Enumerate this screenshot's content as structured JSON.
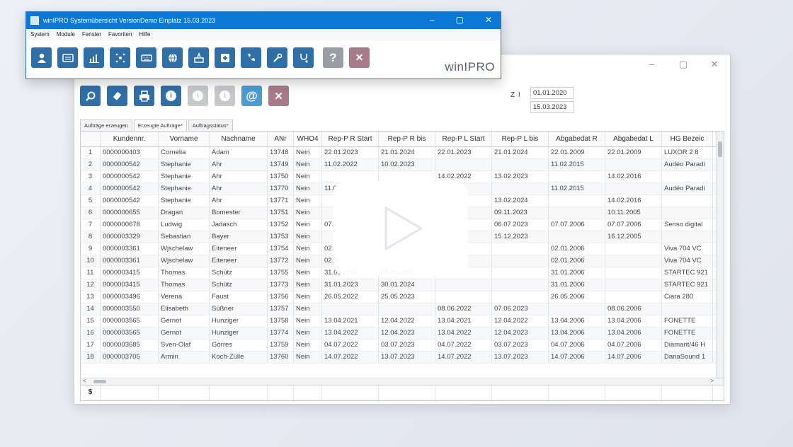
{
  "front_window": {
    "title": "winIPRO Systemübersicht VersionDemo Einplatz 15.03.2023",
    "menu": [
      "System",
      "Module",
      "Fenster",
      "Favoriten",
      "Hilfe"
    ],
    "logo": "winIPRO",
    "toolbar_icons": [
      "user-icon",
      "id-card-icon",
      "bar-chart-icon",
      "network-icon",
      "keyboard-icon",
      "globe-icon",
      "money-icon",
      "plus-box-icon",
      "phone-icon",
      "tools-icon",
      "stethoscope-icon",
      "help-icon",
      "close-icon"
    ],
    "help_glyph": "?",
    "close_glyph": "✕",
    "ctrl_min": "–",
    "ctrl_max": "▢",
    "ctrl_close": "✕"
  },
  "main_window": {
    "ctrl_min": "–",
    "ctrl_max": "▢",
    "ctrl_close": "✕",
    "toolbar_icons": [
      "search-icon",
      "eraser-icon",
      "print-icon",
      "info-icon",
      "info-disabled-icon",
      "info-disabled-icon",
      "email-icon",
      "close-icon"
    ],
    "info_glyph": "i",
    "email_glyph": "@",
    "close_glyph": "✕",
    "zi_label": "Z I",
    "date_from": "01.01.2020",
    "date_to": "15.03.2023",
    "tabs": [
      "Aufträge erzeugen",
      "Erzeugte Aufträge*",
      "Auftragsstatus*"
    ],
    "active_tab": 1
  },
  "table": {
    "columns": [
      "",
      "Kundennr.",
      "Vorname",
      "Nachname",
      "ANr",
      "WHO4",
      "Rep-P R Start",
      "Rep-P R bis",
      "Rep-P L Start",
      "Rep-P L bis",
      "Abgabedat R",
      "Abgabedat L",
      "HG Bezeic"
    ],
    "rows": [
      [
        "1",
        "0000000403",
        "Cornelia",
        "Adam",
        "13748",
        "Nein",
        "22.01.2023",
        "21.01.2024",
        "22.01.2023",
        "21.01.2024",
        "22.01.2009",
        "22.01.2009",
        "LUXOR 2 8"
      ],
      [
        "2",
        "0000000542",
        "Stephanie",
        "Ahr",
        "13749",
        "Nein",
        "11.02.2022",
        "10.02.2023",
        "",
        "",
        "11.02.2015",
        "",
        "Audéo Paradi"
      ],
      [
        "3",
        "0000000542",
        "Stephanie",
        "Ahr",
        "13750",
        "Nein",
        "",
        "",
        "14.02.2022",
        "13.02.2023",
        "",
        "14.02.2016",
        ""
      ],
      [
        "4",
        "0000000542",
        "Stephanie",
        "Ahr",
        "13770",
        "Nein",
        "11.0",
        "",
        "",
        "",
        "11.02.2015",
        "",
        "Audéo Paradi"
      ],
      [
        "5",
        "0000000542",
        "Stephanie",
        "Ahr",
        "13771",
        "Nein",
        "",
        "",
        "",
        "13.02.2024",
        "",
        "14.02.2016",
        ""
      ],
      [
        "6",
        "0000000655",
        "Dragan",
        "Bomester",
        "13751",
        "Nein",
        "",
        "",
        "",
        "09.11.2023",
        "",
        "10.11.2005",
        ""
      ],
      [
        "7",
        "0000000678",
        "Ludwig",
        "Jadasch",
        "13752",
        "Nein",
        "07.",
        "",
        "",
        "06.07.2023",
        "07.07.2006",
        "07.07.2006",
        "Senso digital"
      ],
      [
        "8",
        "0000003329",
        "Sebastian",
        "Bayer",
        "13753",
        "Nein",
        "",
        "",
        "",
        "15.12.2023",
        "",
        "16.12.2005",
        ""
      ],
      [
        "9",
        "0000003361",
        "Wjschelaw",
        "Eiteneer",
        "13754",
        "Nein",
        "02.",
        "",
        "",
        "",
        "02.01.2006",
        "",
        "Viva 704 VC"
      ],
      [
        "10",
        "0000003361",
        "Wjschelaw",
        "Eiteneer",
        "13772",
        "Nein",
        "02.01",
        "",
        "",
        "",
        "02.01.2006",
        "",
        "Viva 704 VC"
      ],
      [
        "11",
        "0000003415",
        "Thomas",
        "Schütz",
        "13755",
        "Nein",
        "31.01.2022",
        "30.01.2023",
        "",
        "",
        "31.01.2006",
        "",
        "STARTEC 921"
      ],
      [
        "12",
        "0000003415",
        "Thomas",
        "Schütz",
        "13773",
        "Nein",
        "31.01.2023",
        "30.01.2024",
        "",
        "",
        "31.01.2006",
        "",
        "STARTEC 921"
      ],
      [
        "13",
        "0000003496",
        "Verena",
        "Faust",
        "13756",
        "Nein",
        "26.05.2022",
        "25.05.2023",
        "",
        "",
        "26.05.2006",
        "",
        "Ciara 280"
      ],
      [
        "14",
        "0000003550",
        "Elisabeth",
        "Süßner",
        "13757",
        "Nein",
        "",
        "",
        "08.06.2022",
        "07.06.2023",
        "",
        "08.06.2006",
        ""
      ],
      [
        "15",
        "0000003565",
        "Gernot",
        "Hunziger",
        "13758",
        "Nein",
        "13.04.2021",
        "12.04.2022",
        "13.04.2021",
        "12.04.2022",
        "13.04.2006",
        "13.04.2006",
        "FONETTE"
      ],
      [
        "16",
        "0000003565",
        "Gernot",
        "Hunziger",
        "13774",
        "Nein",
        "13.04.2022",
        "12.04.2023",
        "13.04.2022",
        "12.04.2023",
        "13.04.2006",
        "13.04.2006",
        "FONETTE"
      ],
      [
        "17",
        "0000003685",
        "Sven-Olaf",
        "Görres",
        "13759",
        "Nein",
        "04.07.2022",
        "03.07.2023",
        "04.07.2022",
        "03.07.2023",
        "04.07.2006",
        "04.07.2006",
        "Diamant/46 H"
      ],
      [
        "18",
        "0000003705",
        "Armin",
        "Koch-Zülle",
        "13760",
        "Nein",
        "14.07.2022",
        "13.07.2023",
        "14.07.2022",
        "13.07.2023",
        "14.07.2006",
        "14.07.2006",
        "DanaSound 1"
      ]
    ],
    "footer_symbol": "$",
    "scroll_left": "<",
    "scroll_right": ">"
  },
  "overlay": {
    "icon": "play-icon"
  }
}
